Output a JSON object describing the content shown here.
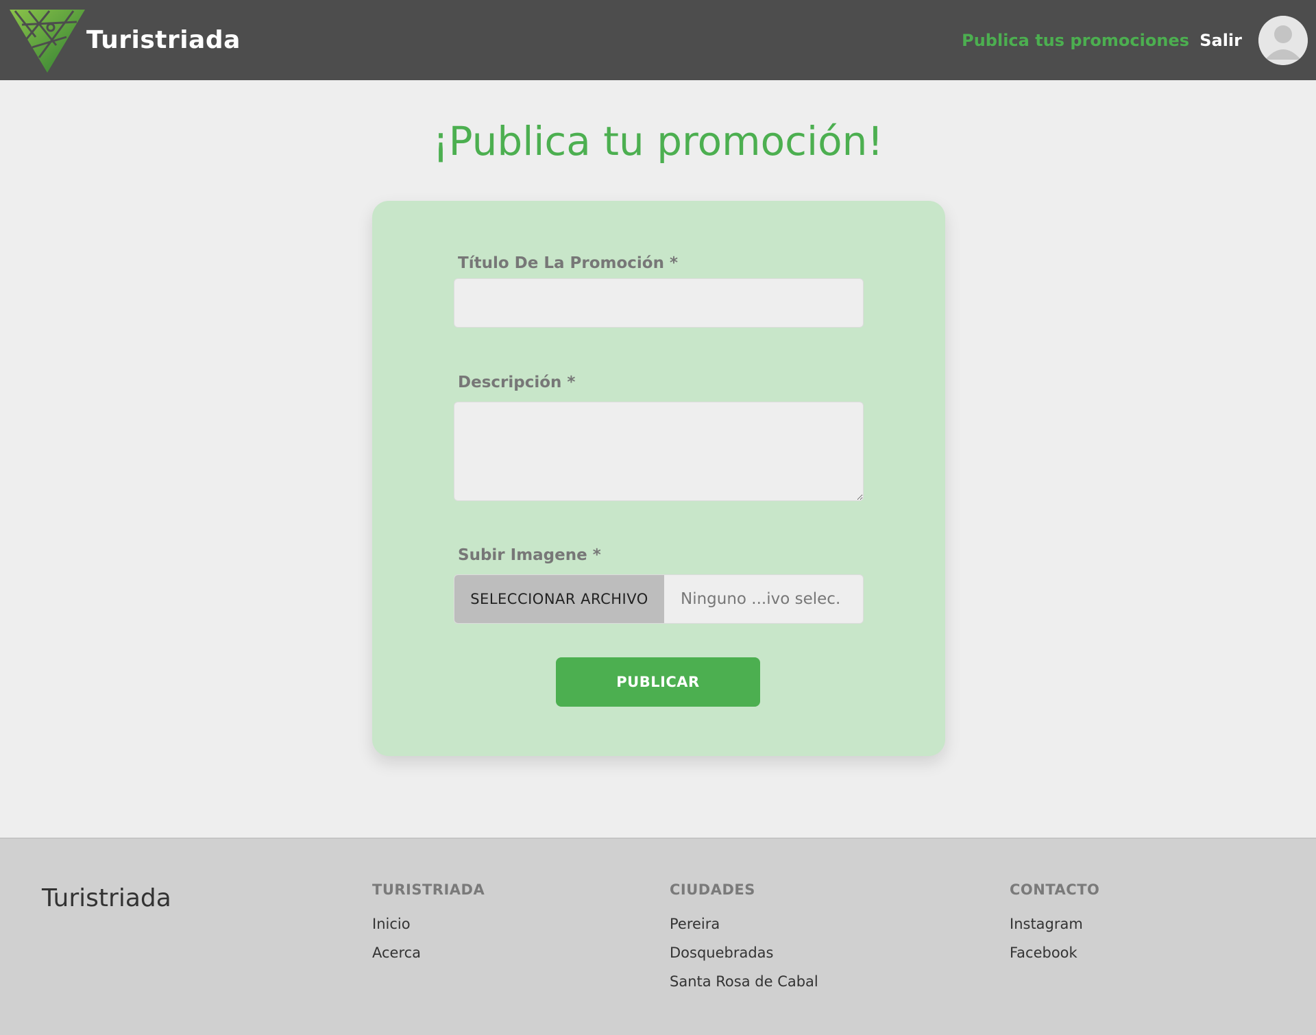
{
  "header": {
    "brand": "Turistriada",
    "nav_promos": "Publica tus promociones",
    "nav_logout": "Salir"
  },
  "main": {
    "title": "¡Publica tu promoción!",
    "form": {
      "title_label": "Título De La Promoción *",
      "title_value": "",
      "description_label": "Descripción *",
      "description_value": "",
      "image_label": "Subir Imagene *",
      "file_button": "SELECCIONAR ARCHIVO",
      "file_status": "Ninguno ...ivo selec.",
      "submit": "PUBLICAR"
    }
  },
  "footer": {
    "brand": "Turistriada",
    "columns": [
      {
        "heading": "TURISTRIADA",
        "links": [
          "Inicio",
          "Acerca"
        ]
      },
      {
        "heading": "CIUDADES",
        "links": [
          "Pereira",
          "Dosquebradas",
          "Santa Rosa de Cabal"
        ]
      },
      {
        "heading": "CONTACTO",
        "links": [
          "Instagram",
          "Facebook"
        ]
      }
    ]
  },
  "colors": {
    "accent": "#4caf50",
    "header_bg": "#4d4d4d",
    "card_bg": "#c8e6c9",
    "footer_bg": "#d0d0d0"
  },
  "icons": {
    "logo": "turistriada-logo-icon",
    "avatar": "user-avatar-icon"
  }
}
